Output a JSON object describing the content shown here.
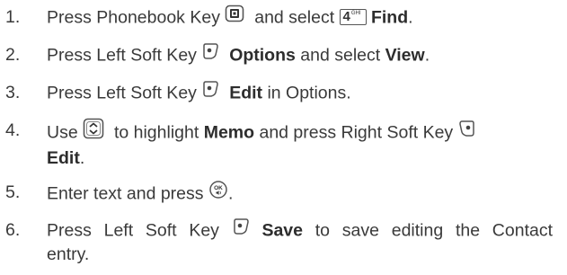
{
  "steps": [
    {
      "number": "1.",
      "t1": "Press Phonebook Key",
      "t2": "and select",
      "key_digit": "4",
      "key_letters": "GHI",
      "t3": "Find",
      "t4": ".",
      "icons": [
        "phonebook-key-icon",
        "key-4-ghi-icon"
      ]
    },
    {
      "number": "2.",
      "t1": "Press Left Soft Key",
      "t2": "Options",
      "t3": "and select",
      "t4": "View",
      "t5": ".",
      "icons": [
        "left-soft-key-icon"
      ]
    },
    {
      "number": "3.",
      "t1": "Press Left Soft Key",
      "t2": "Edit",
      "t3": "in Options.",
      "icons": [
        "left-soft-key-icon"
      ]
    },
    {
      "number": "4.",
      "t1": "Use",
      "t2": "to highlight",
      "t3": "Memo",
      "t4": "and press Right Soft Key",
      "t5": "Edit",
      "t6": ".",
      "icons": [
        "navigation-key-icon",
        "right-soft-key-icon"
      ]
    },
    {
      "number": "5.",
      "t1": "Enter text and press",
      "t2": ".",
      "icons": [
        "ok-key-icon"
      ]
    },
    {
      "number": "6.",
      "t1": "Press Left Soft Key",
      "t2": "Save",
      "t3": "to save editing the Contact",
      "t4": "entry.",
      "icons": [
        "left-soft-key-icon"
      ]
    }
  ]
}
